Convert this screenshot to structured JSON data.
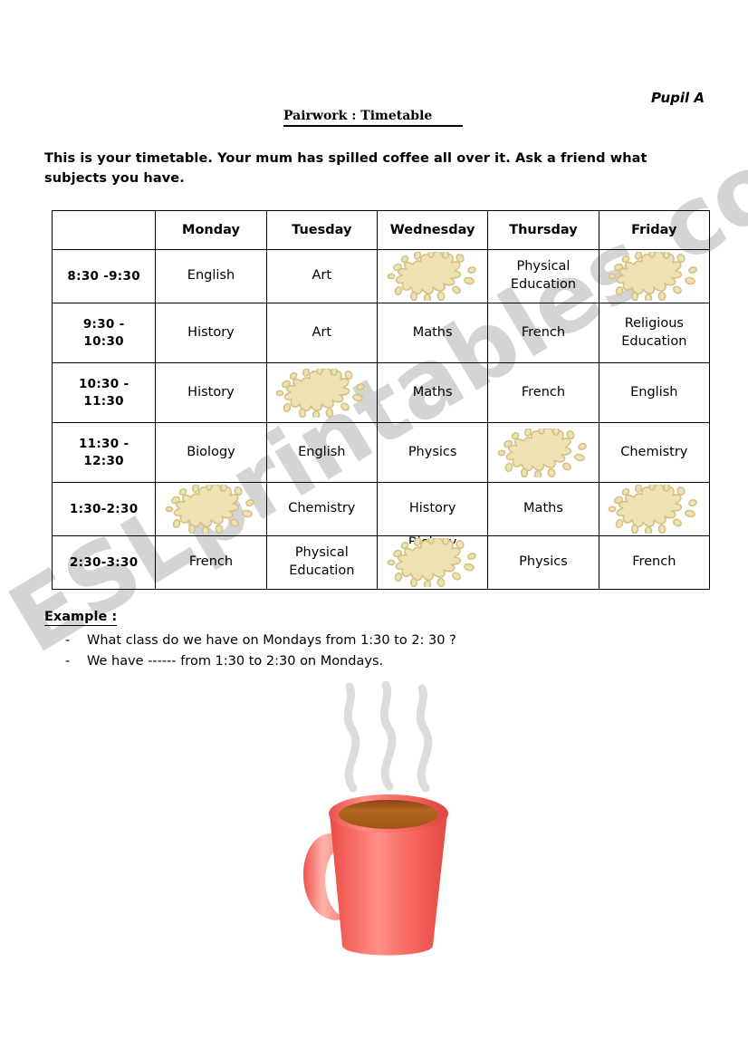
{
  "header": {
    "pupil_label": "Pupil A",
    "title": "Pairwork : Timetable"
  },
  "intro": "This is your timetable.  Your mum has spilled coffee all over it.  Ask a friend what subjects you have.",
  "timetable": {
    "corner_label": "",
    "day_headers": [
      "Monday",
      "Tuesday",
      "Wednesday",
      "Thursday",
      "Friday"
    ],
    "rows": [
      {
        "time": "8:30  -9:30",
        "time_line2": "",
        "cells": [
          {
            "type": "subject",
            "text": "English"
          },
          {
            "type": "subject",
            "text": "Art"
          },
          {
            "type": "stain",
            "text": ""
          },
          {
            "type": "subject",
            "text": "Physical Education"
          },
          {
            "type": "stain",
            "text": ""
          }
        ]
      },
      {
        "time": "9:30 -",
        "time_line2": "10:30",
        "cells": [
          {
            "type": "subject",
            "text": "History"
          },
          {
            "type": "subject",
            "text": "Art"
          },
          {
            "type": "subject",
            "text": "Maths"
          },
          {
            "type": "subject",
            "text": "French"
          },
          {
            "type": "subject",
            "text": "Religious Education"
          }
        ]
      },
      {
        "time": "10:30  -",
        "time_line2": "11:30",
        "cells": [
          {
            "type": "subject",
            "text": "History"
          },
          {
            "type": "stain",
            "text": ""
          },
          {
            "type": "subject",
            "text": "Maths"
          },
          {
            "type": "subject",
            "text": "French"
          },
          {
            "type": "subject",
            "text": "English"
          }
        ]
      },
      {
        "time": "11:30  -",
        "time_line2": "12:30",
        "cells": [
          {
            "type": "subject",
            "text": "Biology"
          },
          {
            "type": "subject",
            "text": "English"
          },
          {
            "type": "subject",
            "text": "Physics"
          },
          {
            "type": "stain",
            "text": ""
          },
          {
            "type": "subject",
            "text": "Chemistry"
          }
        ]
      },
      {
        "time": "1:30-2:30",
        "time_line2": "",
        "cells": [
          {
            "type": "stain",
            "text": ""
          },
          {
            "type": "subject",
            "text": "Chemistry"
          },
          {
            "type": "subject",
            "text": "History"
          },
          {
            "type": "subject",
            "text": "Maths"
          },
          {
            "type": "stain",
            "text": ""
          }
        ]
      },
      {
        "time": "2:30-3:30",
        "time_line2": "",
        "cells": [
          {
            "type": "subject",
            "text": "French"
          },
          {
            "type": "subject",
            "text": "Physical Education"
          },
          {
            "type": "stain",
            "text": "Biology"
          },
          {
            "type": "subject",
            "text": "Physics"
          },
          {
            "type": "subject",
            "text": "French"
          }
        ]
      }
    ]
  },
  "example": {
    "heading": "Example :",
    "dash": "-",
    "lines": [
      "What class do we have on Mondays from 1:30 to 2: 30 ?",
      "We have ------ from 1:30 to 2:30 on Mondays."
    ]
  },
  "watermark": "ESLprintables.com",
  "colors": {
    "stain_fill": "#ece2b4",
    "stain_stroke": "#d6c182",
    "mug_body": "#f4645f",
    "mug_light": "#ff8f86",
    "coffee": "#a95a22",
    "steam": "#d9d9d9",
    "watermark": "#c9c9c9"
  }
}
